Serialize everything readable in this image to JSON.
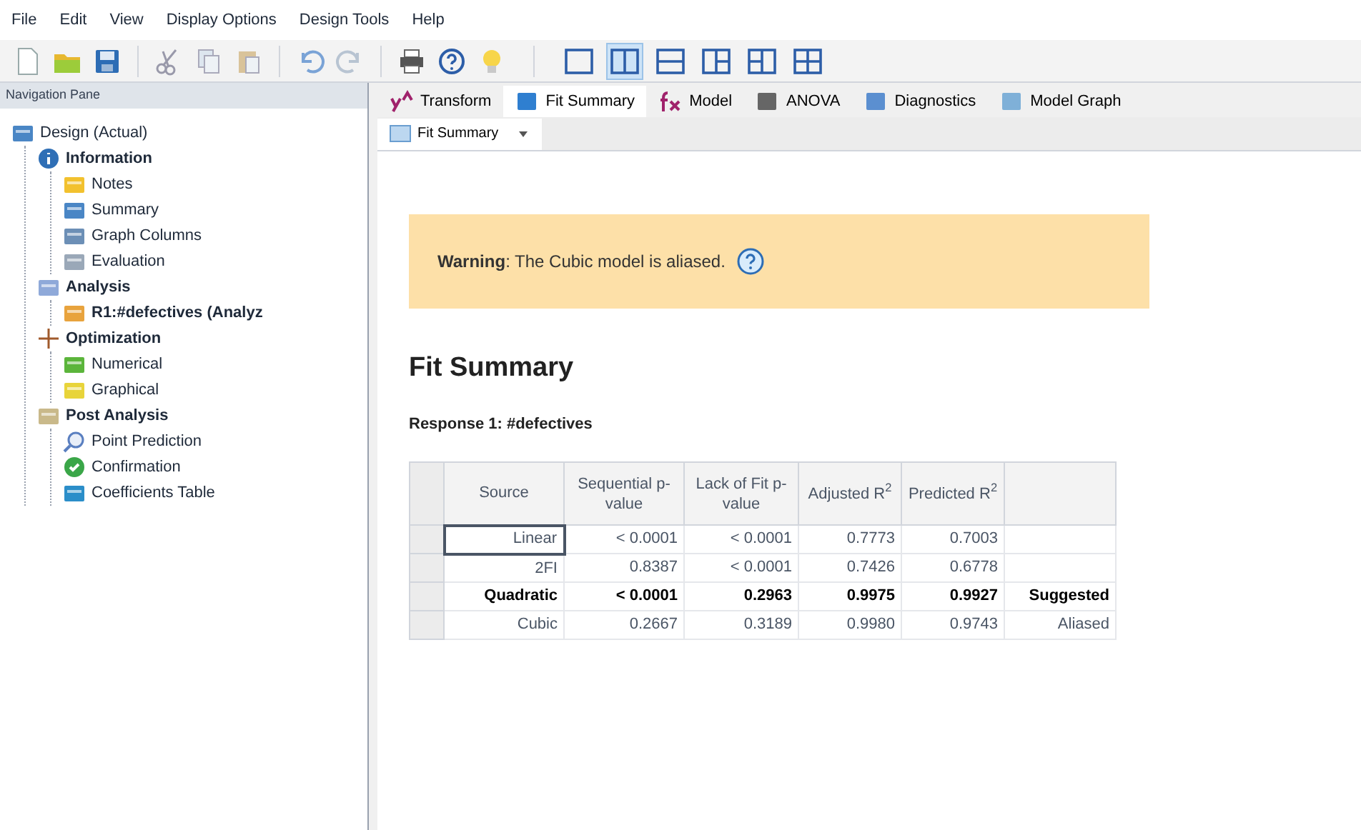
{
  "menu": [
    "File",
    "Edit",
    "View",
    "Display Options",
    "Design Tools",
    "Help"
  ],
  "toolbar": [
    {
      "kind": "new"
    },
    {
      "kind": "open"
    },
    {
      "kind": "save"
    },
    {
      "kind": "sep"
    },
    {
      "kind": "cut"
    },
    {
      "kind": "copy"
    },
    {
      "kind": "paste"
    },
    {
      "kind": "sep"
    },
    {
      "kind": "undo"
    },
    {
      "kind": "redo"
    },
    {
      "kind": "sep"
    },
    {
      "kind": "print"
    },
    {
      "kind": "help"
    },
    {
      "kind": "tip"
    }
  ],
  "layouts": [
    {
      "kind": "single",
      "selected": false
    },
    {
      "kind": "cols",
      "selected": true
    },
    {
      "kind": "rows",
      "selected": false
    },
    {
      "kind": "left3",
      "selected": false
    },
    {
      "kind": "right3",
      "selected": false
    },
    {
      "kind": "quad",
      "selected": false
    }
  ],
  "nav": {
    "title": "Navigation Pane",
    "tree": [
      {
        "label": "Design (Actual)",
        "kind": "table",
        "bold": false,
        "children": [
          {
            "label": "Information",
            "kind": "info",
            "bold": true,
            "children": [
              {
                "label": "Notes",
                "kind": "folder",
                "bold": false
              },
              {
                "label": "Summary",
                "kind": "table",
                "bold": false
              },
              {
                "label": "Graph Columns",
                "kind": "graph",
                "bold": false
              },
              {
                "label": "Evaluation",
                "kind": "eval",
                "bold": false
              }
            ]
          },
          {
            "label": "Analysis",
            "kind": "analysis",
            "bold": true,
            "children": [
              {
                "label": "R1:#defectives (Analyz",
                "kind": "response",
                "bold": true
              }
            ]
          },
          {
            "label": "Optimization",
            "kind": "opt",
            "bold": true,
            "children": [
              {
                "label": "Numerical",
                "kind": "num",
                "bold": false
              },
              {
                "label": "Graphical",
                "kind": "graphical",
                "bold": false
              }
            ]
          },
          {
            "label": "Post Analysis",
            "kind": "post",
            "bold": true,
            "children": [
              {
                "label": "Point Prediction",
                "kind": "point",
                "bold": false
              },
              {
                "label": "Confirmation",
                "kind": "confirm",
                "bold": false
              },
              {
                "label": "Coefficients Table",
                "kind": "coef",
                "bold": false
              }
            ]
          }
        ]
      }
    ]
  },
  "tabs": [
    {
      "label": "Transform",
      "kind": "transform",
      "selected": false
    },
    {
      "label": "Fit Summary",
      "kind": "fit",
      "selected": true
    },
    {
      "label": "Model",
      "kind": "model",
      "selected": false
    },
    {
      "label": "ANOVA",
      "kind": "anova",
      "selected": false
    },
    {
      "label": "Diagnostics",
      "kind": "diag",
      "selected": false
    },
    {
      "label": "Model Graph",
      "kind": "graphs",
      "selected": false
    }
  ],
  "view_selector": "Fit Summary",
  "warning": "**Warning**: The Cubic model is aliased.",
  "heading": "Fit Summary",
  "response": "Response 1: #defectives",
  "table": {
    "columns": [
      "Source",
      "Sequential p-value",
      "Lack of Fit p-value",
      "Adjusted R$^{2}$",
      "Predicted R$^{2}$",
      ""
    ],
    "rows": [
      {
        "cells": [
          "Linear",
          "< 0.0001",
          "< 0.0001",
          "0.7773",
          "0.7003",
          ""
        ],
        "emphasized": false,
        "focused": true
      },
      {
        "cells": [
          "2FI",
          "0.8387",
          "< 0.0001",
          "0.7426",
          "0.6778",
          ""
        ],
        "emphasized": false,
        "focused": false
      },
      {
        "cells": [
          "Quadratic",
          "< 0.0001",
          "0.2963",
          "0.9975",
          "0.9927",
          "Suggested"
        ],
        "emphasized": true,
        "focused": false
      },
      {
        "cells": [
          "Cubic",
          "0.2667",
          "0.3189",
          "0.9980",
          "0.9743",
          "Aliased"
        ],
        "emphasized": false,
        "focused": false
      }
    ]
  }
}
